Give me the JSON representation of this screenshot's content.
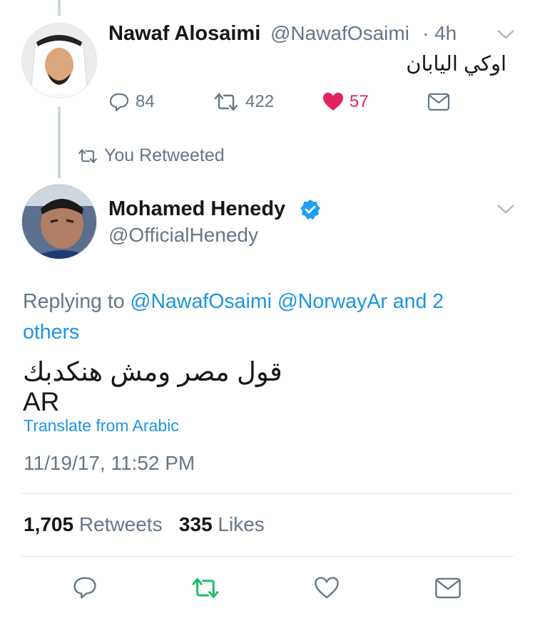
{
  "tweet1": {
    "name": "Nawaf Alosaimi",
    "handle": "@NawafOsaimi",
    "time": "· 4h",
    "text": "اوكي اليابان",
    "replies": "84",
    "retweets": "422",
    "likes": "57"
  },
  "retweet_notice": "You Retweeted",
  "tweet2": {
    "name": "Mohamed Henedy",
    "handle": "@OfficialHenedy",
    "replying_prefix": "Replying to ",
    "reply_user1": "@NawafOsaimi",
    "reply_user2": "@NorwayAr",
    "reply_others": "and 2 others",
    "text": "قول مصر ومش هنكدبك AR",
    "translate": "Translate from Arabic",
    "timestamp": "11/19/17, 11:52 PM",
    "retweet_count": "1,705",
    "retweet_label": "Retweets",
    "like_count": "335",
    "like_label": "Likes"
  },
  "colors": {
    "accent": "#1b95e0",
    "retweet_green": "#17bf63",
    "like_red": "#e0245e",
    "muted": "#657786"
  }
}
